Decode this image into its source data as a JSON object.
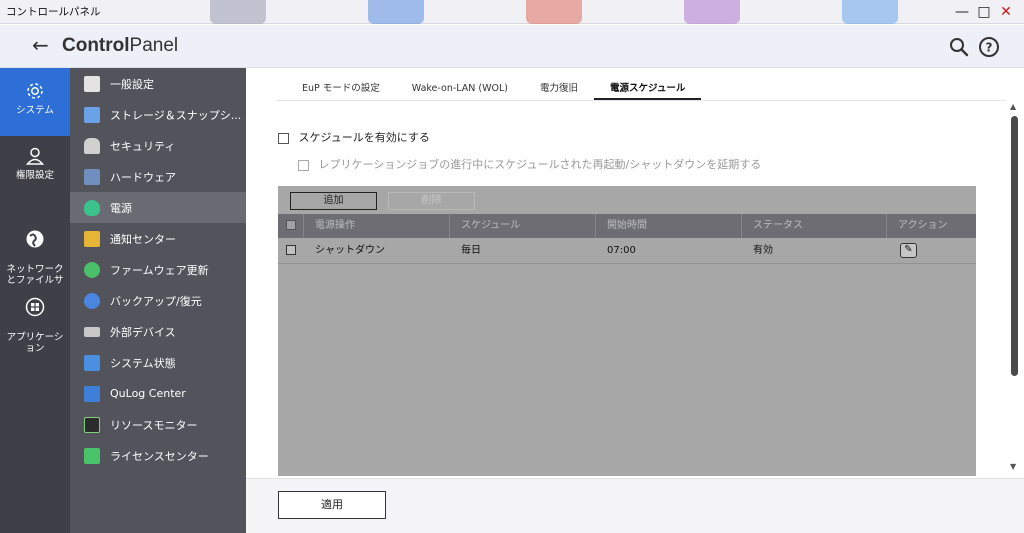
{
  "window": {
    "title": "コントロールパネル",
    "minimize": "—",
    "maximize": "□",
    "close": "✕"
  },
  "header": {
    "back_icon": "back-arrow-icon",
    "title_bold": "Control",
    "title_rest": "Panel",
    "search_icon": "search-icon",
    "help_icon": "help-icon"
  },
  "rail": [
    {
      "label": "システム",
      "icon": "gear-icon",
      "active": true
    },
    {
      "label": "権限設定",
      "icon": "user-icon"
    },
    {
      "label": "ネットワーク\nとファイルサ",
      "icon": "globe-icon"
    },
    {
      "label": "アプリケーシ\nョン",
      "icon": "apps-grid-icon"
    }
  ],
  "subnav": [
    {
      "label": "一般設定",
      "icon": "general-settings-icon",
      "color": "#e3e3e3"
    },
    {
      "label": "ストレージ＆スナップシ...",
      "icon": "storage-icon",
      "color": "#6aa2e8"
    },
    {
      "label": "セキュリティ",
      "icon": "lock-icon",
      "color": "#d0d0d0"
    },
    {
      "label": "ハードウェア",
      "icon": "hardware-icon",
      "color": "#6f8fbf"
    },
    {
      "label": "電源",
      "icon": "power-icon",
      "color": "#3cc28c",
      "active": true
    },
    {
      "label": "通知センター",
      "icon": "notification-icon",
      "color": "#e6b536"
    },
    {
      "label": "ファームウェア更新",
      "icon": "firmware-icon",
      "color": "#4cbf6a"
    },
    {
      "label": "バックアップ/復元",
      "icon": "backup-icon",
      "color": "#4a86e0"
    },
    {
      "label": "外部デバイス",
      "icon": "external-device-icon",
      "color": "#c8c8c8"
    },
    {
      "label": "システム状態",
      "icon": "system-status-icon",
      "color": "#4a8fe0"
    },
    {
      "label": "QuLog Center",
      "icon": "qulog-icon",
      "color": "#3d7fd9"
    },
    {
      "label": "リソースモニター",
      "icon": "resource-monitor-icon",
      "color": "#2b2b2b"
    },
    {
      "label": "ライセンスセンター",
      "icon": "license-icon",
      "color": "#49c46b"
    }
  ],
  "tabs": [
    {
      "label": "EuP モードの設定"
    },
    {
      "label": "Wake-on-LAN (WOL)"
    },
    {
      "label": "電力復旧"
    },
    {
      "label": "電源スケジュール",
      "active": true
    }
  ],
  "options": {
    "enable_schedule": "スケジュールを有効にする",
    "delay_schedule": "レプリケーションジョブの進行中にスケジュールされた再起動/シャットダウンを延期する"
  },
  "table": {
    "add_label": "追加",
    "delete_label": "削除",
    "columns": [
      "電源操作",
      "スケジュール",
      "開始時間",
      "ステータス",
      "アクション"
    ],
    "rows": [
      {
        "operation": "シャットダウン",
        "schedule": "毎日",
        "start": "07:00",
        "status": "有効",
        "action_icon": "edit-icon"
      }
    ]
  },
  "footer": {
    "apply_label": "適用"
  }
}
